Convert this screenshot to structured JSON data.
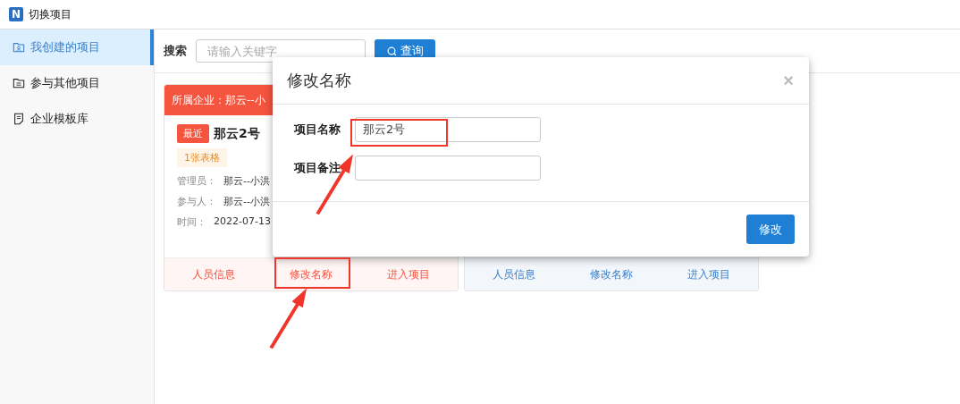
{
  "window": {
    "title": "切换项目",
    "logo": "N"
  },
  "sidebar": {
    "items": [
      {
        "label": "我创建的项目",
        "selected": true
      },
      {
        "label": "参与其他项目",
        "selected": false
      },
      {
        "label": "企业模板库",
        "selected": false
      }
    ]
  },
  "search": {
    "label": "搜索",
    "placeholder": "请输入关键字",
    "button": "查询"
  },
  "cards": [
    {
      "kind": "recent",
      "header": "所属企业：那云--小",
      "badge": "最近",
      "name": "那云2号",
      "tag": "1张表格",
      "fields": [
        {
          "label": "管理员：",
          "value": "那云--小洪"
        },
        {
          "label": "参与人：",
          "value": "那云--小洪"
        },
        {
          "label": "时间：",
          "value": "2022-07-13"
        }
      ],
      "actions": [
        "人员信息",
        "修改名称",
        "进入项目"
      ]
    },
    {
      "kind": "normal",
      "actions": [
        "人员信息",
        "修改名称",
        "进入项目"
      ]
    }
  ],
  "dialog": {
    "title": "修改名称",
    "close": "×",
    "fields": [
      {
        "label": "项目名称",
        "value": "那云2号"
      },
      {
        "label": "项目备注"
      }
    ],
    "submit": "修改"
  }
}
